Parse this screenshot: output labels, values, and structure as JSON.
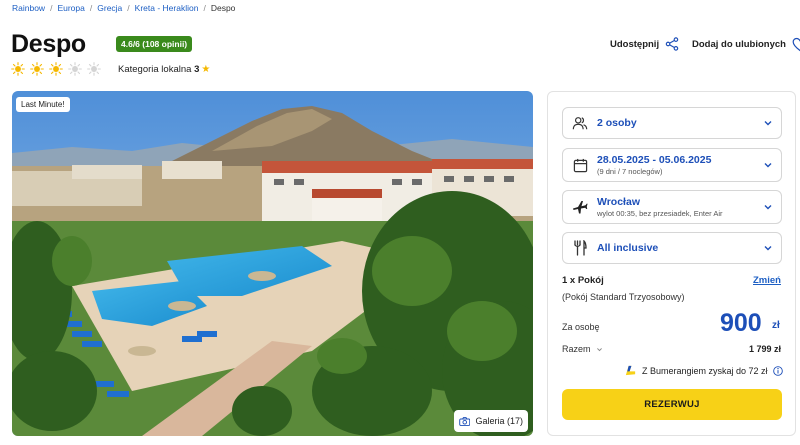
{
  "breadcrumb": {
    "items": [
      "Rainbow",
      "Europa",
      "Grecja",
      "Kreta - Heraklion"
    ],
    "current": "Despo"
  },
  "hotel": {
    "name": "Despo",
    "rating_badge": "4.6/6 (108 opinii)",
    "sun_rating": 3,
    "sun_total": 5,
    "category_label": "Kategoria lokalna",
    "category_value": "3"
  },
  "actions": {
    "share_label": "Udostępnij",
    "favorite_label": "Dodaj do ulubionych"
  },
  "photo": {
    "badge": "Last Minute!",
    "gallery_label": "Galeria (17)"
  },
  "booking": {
    "persons": {
      "label": "2 osoby",
      "icon": "person-icon"
    },
    "dates": {
      "label": "28.05.2025 - 05.06.2025",
      "sub": "(9 dni / 7 noclegów)",
      "icon": "calendar-icon"
    },
    "flight": {
      "label": "Wrocław",
      "sub": "wylot 00:35, bez przesiadek, Enter Air",
      "icon": "plane-icon"
    },
    "board": {
      "label": "All inclusive",
      "icon": "cutlery-icon"
    },
    "room_count": "1 x Pokój",
    "change_label": "Zmień",
    "room_type": "(Pokój Standard Trzyosobowy)",
    "per_person_label": "Za osobę",
    "price": "900",
    "currency": "zł",
    "total_label": "Razem",
    "total_value": "1 799 zł",
    "boomerang_text": "Z Bumerangiem zyskaj do 72 zł",
    "reserve_label": "REZERWUJ"
  },
  "colors": {
    "accent_blue": "#1d4fb8",
    "rating_green": "#3a8a1c",
    "cta_yellow": "#f7d117",
    "sun_gold": "#f5b800"
  }
}
